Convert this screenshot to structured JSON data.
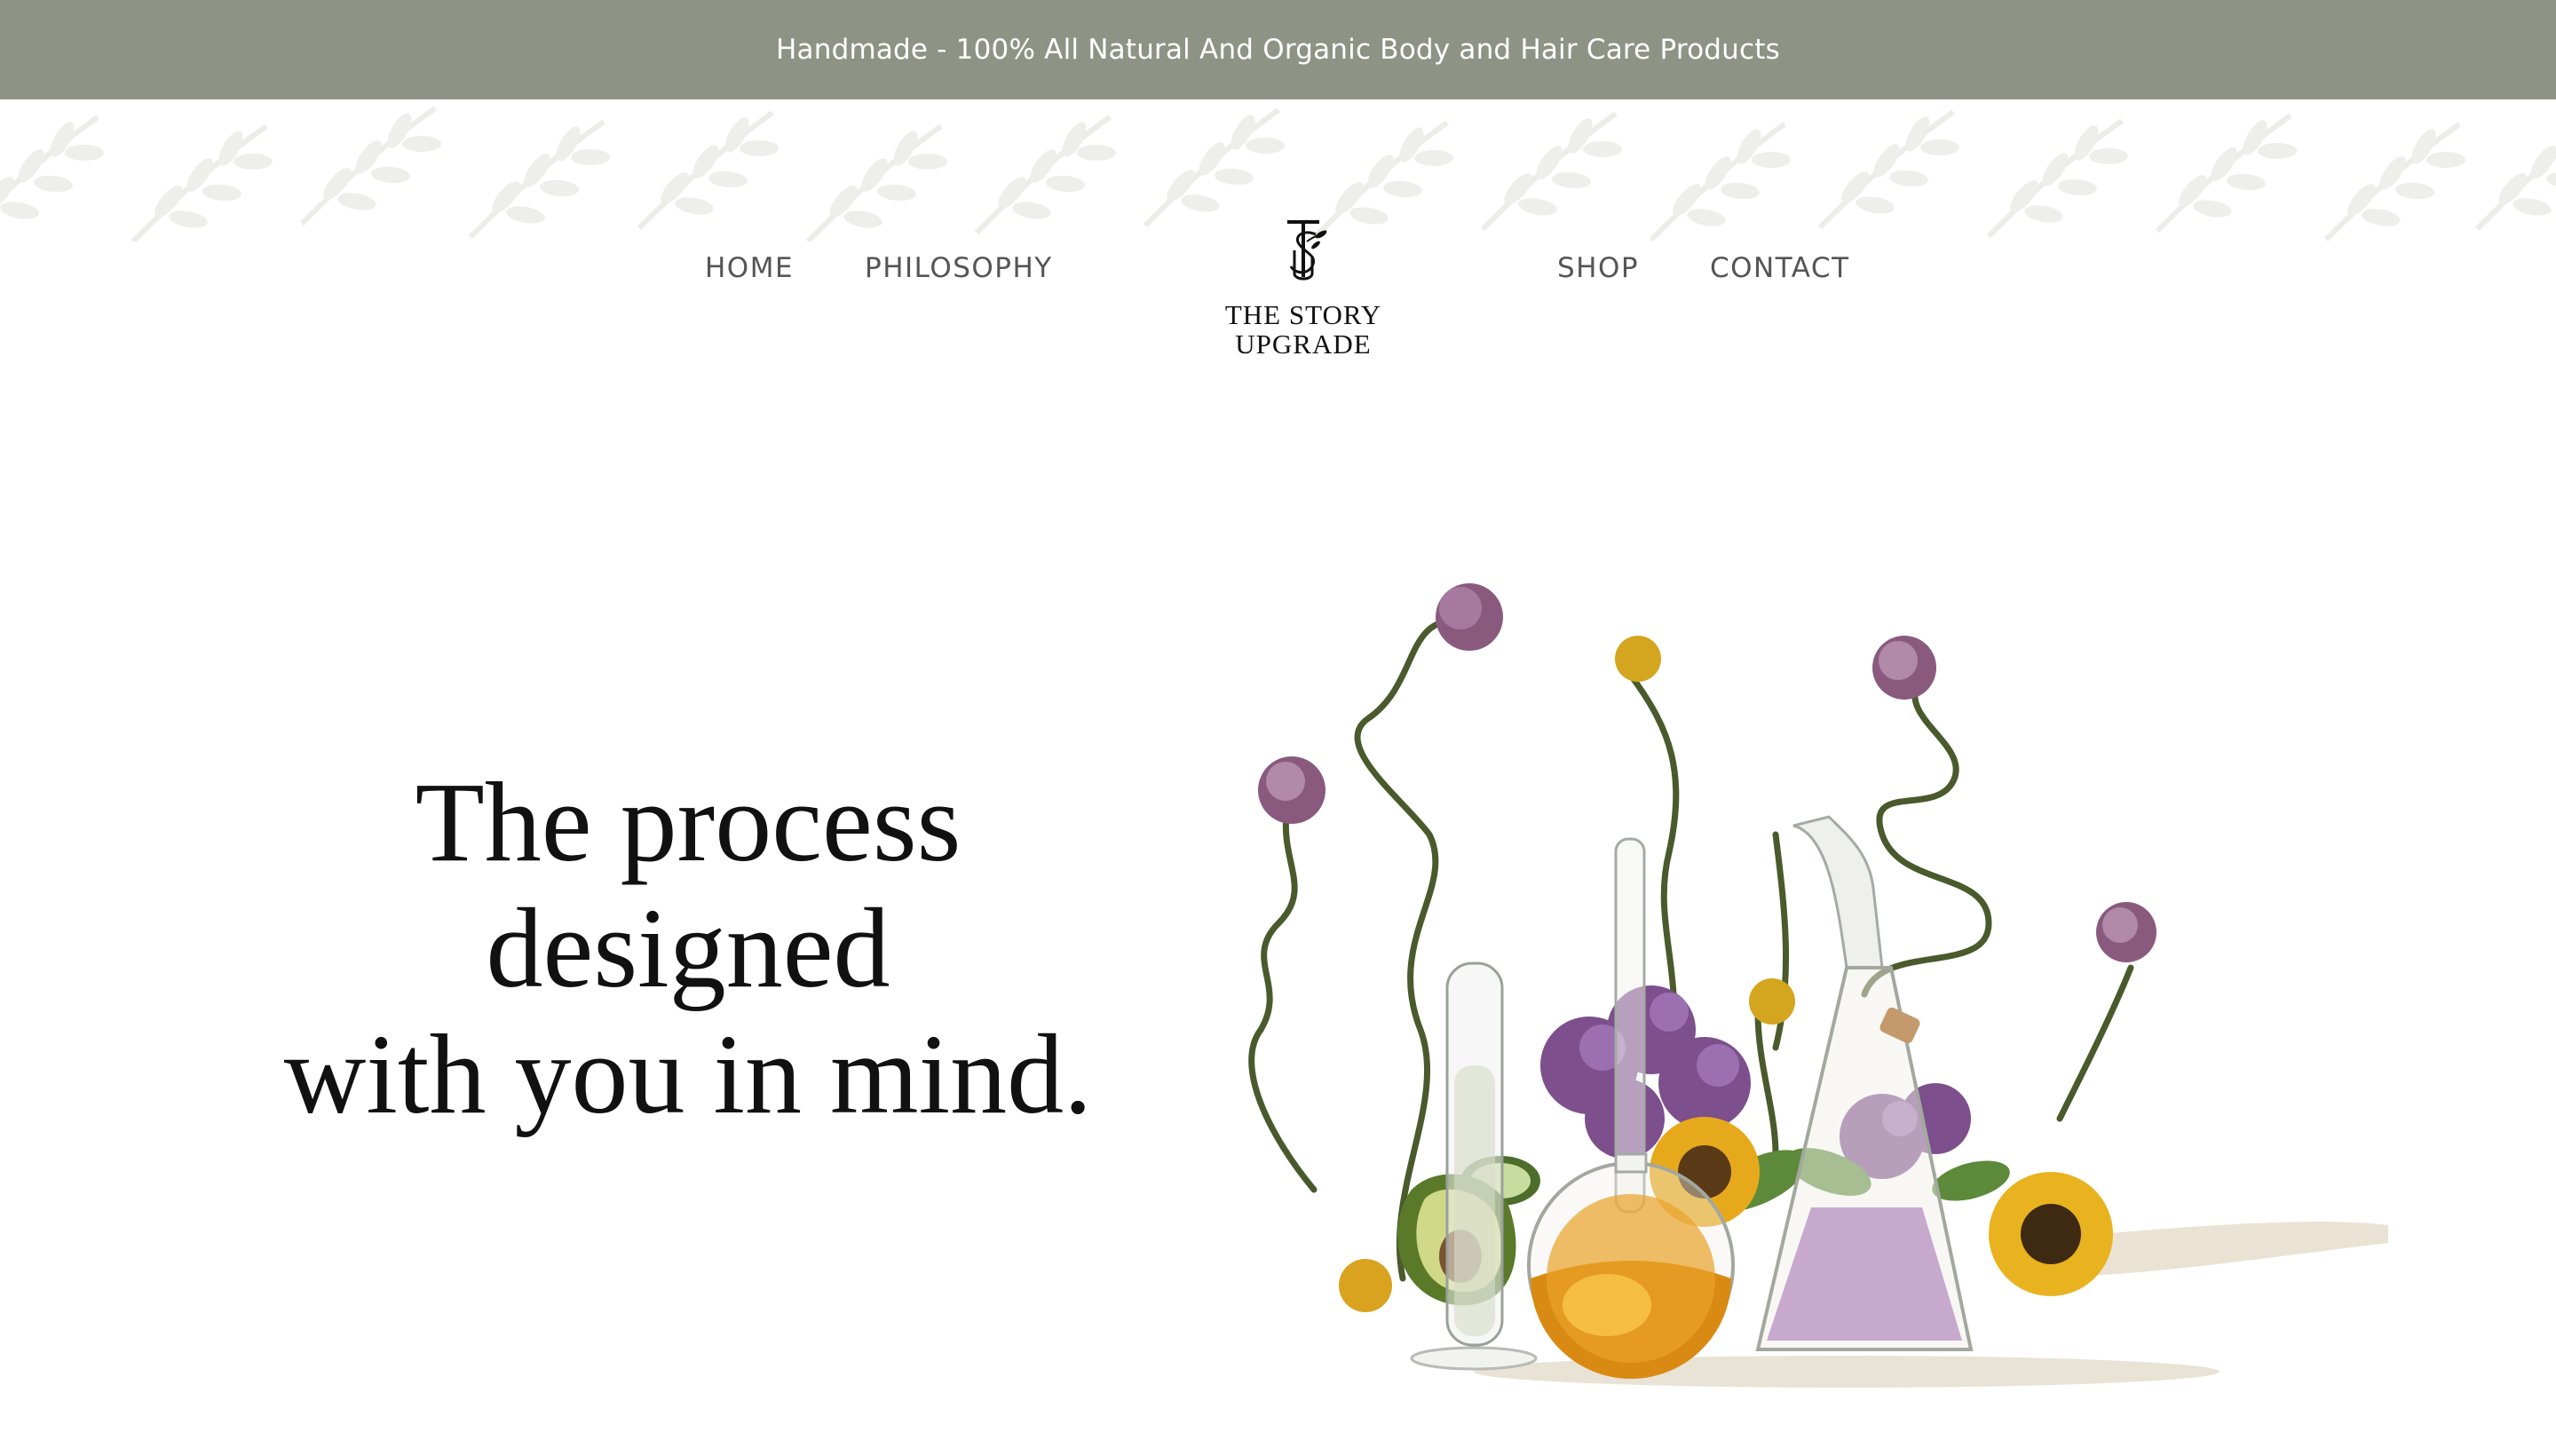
{
  "announcement": {
    "text": "Handmade - 100% All Natural And Organic Body and Hair Care Products"
  },
  "nav": {
    "home": "HOME",
    "philosophy": "PHILOSOPHY",
    "shop": "SHOP",
    "contact": "CONTACT"
  },
  "logo": {
    "line1": "THE STORY",
    "line2": "UPGRADE"
  },
  "hero": {
    "line1": "The process",
    "line2": "designed",
    "line3": "with you in mind."
  },
  "colors": {
    "announcement_bg": "#8f9386",
    "text_dark": "#111111",
    "nav_text": "#555555"
  }
}
